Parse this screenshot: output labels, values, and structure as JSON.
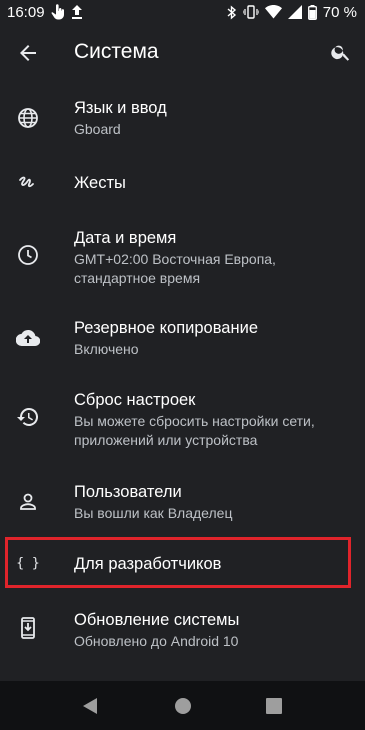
{
  "status_bar": {
    "time": "16:09",
    "battery": "70 %",
    "icons": [
      "touch-icon",
      "upload-icon",
      "bluetooth-icon",
      "vibrate-icon",
      "wifi-icon",
      "signal-icon",
      "battery-icon"
    ]
  },
  "app_bar": {
    "title": "Система",
    "back_icon": "arrow-back-icon",
    "search_icon": "search-icon"
  },
  "items": [
    {
      "icon": "globe-icon",
      "title": "Язык и ввод",
      "summary": "Gboard"
    },
    {
      "icon": "gesture-icon",
      "title": "Жесты",
      "summary": ""
    },
    {
      "icon": "clock-icon",
      "title": "Дата и время",
      "summary": "GMT+02:00 Восточная Европа, стандартное время"
    },
    {
      "icon": "cloud-upload-icon",
      "title": "Резервное копирование",
      "summary": "Включено"
    },
    {
      "icon": "restore-icon",
      "title": "Сброс настроек",
      "summary": "Вы можете сбросить настройки сети, приложений или устройства"
    },
    {
      "icon": "person-icon",
      "title": "Пользователи",
      "summary": "Вы вошли как Владелец"
    },
    {
      "icon": "code-braces-icon",
      "title": "Для разработчиков",
      "summary": ""
    },
    {
      "icon": "system-update-icon",
      "title": "Обновление системы",
      "summary": "Обновлено до Android 10"
    }
  ],
  "highlight_color": "#e0242b",
  "nav_bar": {
    "icons": [
      "back-triangle-icon",
      "home-circle-icon",
      "recents-square-icon"
    ]
  }
}
